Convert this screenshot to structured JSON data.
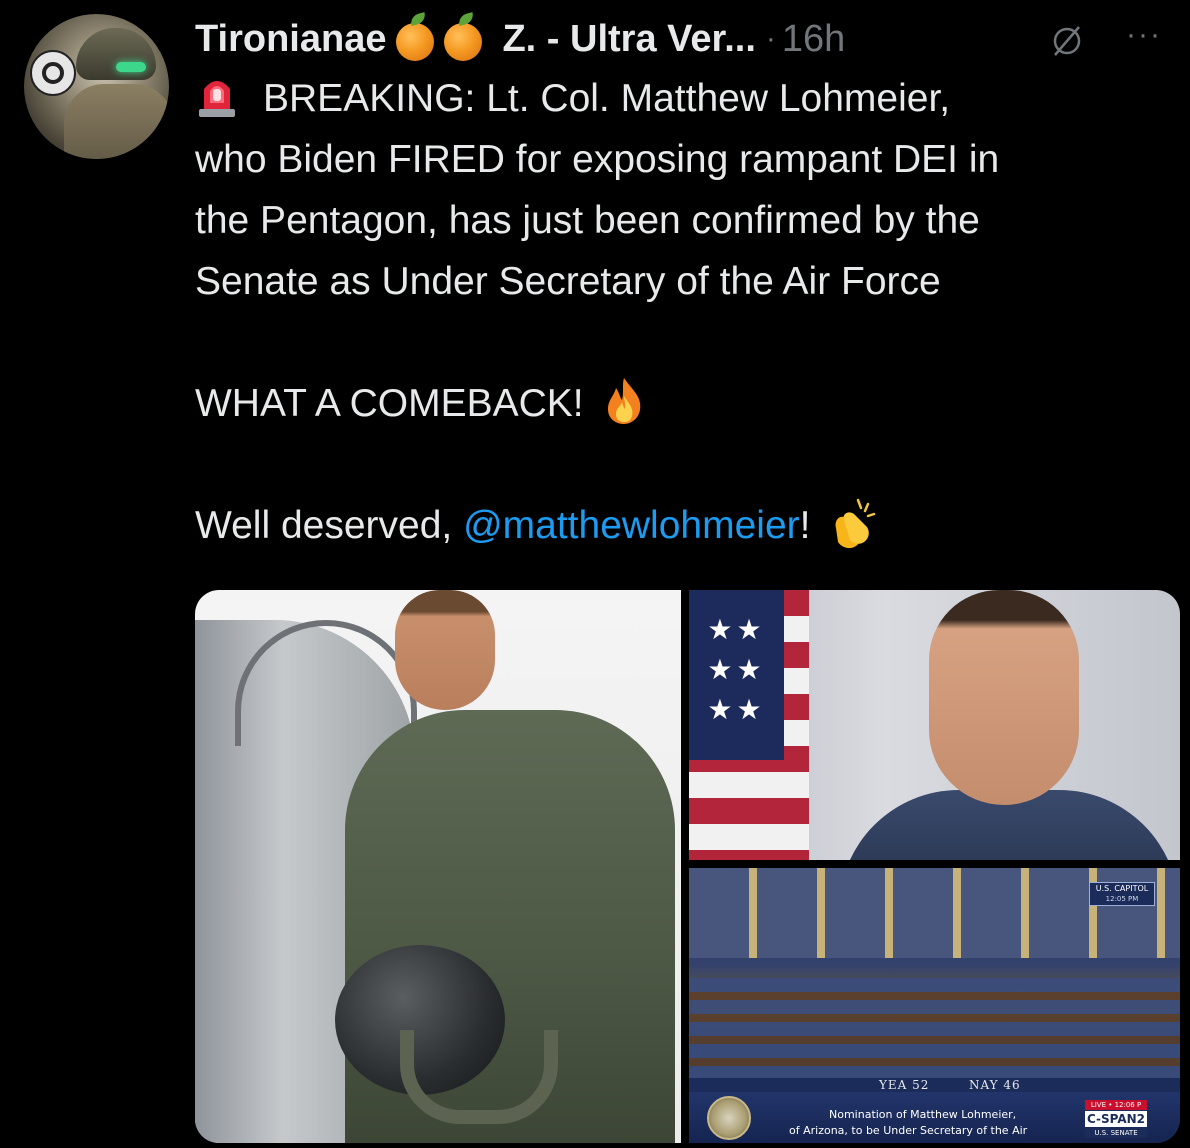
{
  "author": {
    "display_name": "Tironianae",
    "name_emojis": [
      "orange-emoji",
      "orange-emoji"
    ],
    "secondary_name": "Z. - Ultra Ver...",
    "separator": "·",
    "timestamp": "16h",
    "more_label": "···"
  },
  "tweet": {
    "lines": [
      "BREAKING: Lt. Col. Matthew Lohmeier,",
      "who Biden FIRED for exposing rampant DEI in",
      "the Pentagon, has just been confirmed by the",
      "Senate as Under Secretary of the Air Force"
    ],
    "exclamation": "WHAT A COMEBACK!",
    "closing_prefix": "Well deserved, ",
    "mention": "@matthewlohmeier",
    "closing_suffix": "!",
    "icons": {
      "siren": "police-siren-emoji",
      "fire": "fire-emoji",
      "clap": "clapping-hands-emoji"
    }
  },
  "media": {
    "senate_screen": {
      "capitol_label": "U.S. CAPITOL",
      "capitol_time": "12:05 PM",
      "yea": "YEA 52",
      "nay": "NAY 46",
      "chyron_line1": "Nomination of Matthew Lohmeier,",
      "chyron_line2": "of Arizona, to be Under Secretary of the Air",
      "live_label": "LIVE • 12:06 P",
      "network": "C-SPAN2",
      "network_sub": "U.S. SENATE"
    }
  },
  "colors": {
    "background": "#000000",
    "text": "#e7e9ea",
    "muted": "#71767b",
    "link": "#1d9bf0"
  }
}
